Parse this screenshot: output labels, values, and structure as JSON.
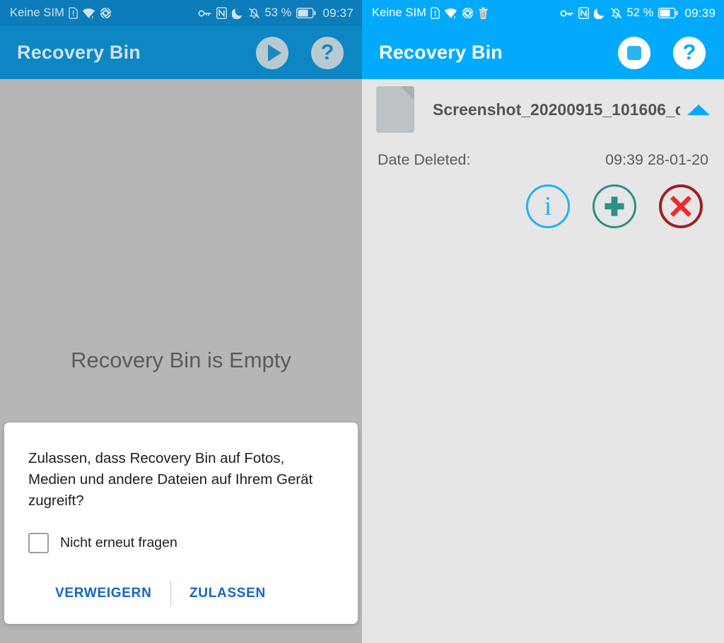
{
  "left": {
    "statusbar": {
      "carrier": "Keine SIM",
      "icons_left": [
        "sim-alert-icon",
        "wifi-icon",
        "camera-shutter-icon"
      ],
      "icons_right": [
        "vpn-key-icon",
        "nfc-icon",
        "do-not-disturb-moon-icon",
        "mute-bell-icon"
      ],
      "battery_percent": "53 %",
      "battery_icon": "battery-icon",
      "clock": "09:37"
    },
    "appbar": {
      "title": "Recovery Bin",
      "play_label": "play-icon",
      "help_label": "?"
    },
    "empty_message": "Recovery Bin is Empty",
    "dialog": {
      "message": "Zulassen, dass Recovery Bin auf Fotos, Medien und andere Dateien auf Ihrem Gerät zugreift?",
      "checkbox_label": "Nicht erneut fragen",
      "checkbox_checked": false,
      "deny_label": "VERWEIGERN",
      "allow_label": "ZULASSEN"
    }
  },
  "right": {
    "statusbar": {
      "carrier": "Keine SIM",
      "icons_left": [
        "sim-alert-icon",
        "wifi-icon",
        "camera-shutter-icon",
        "trash-bin-icon"
      ],
      "icons_right": [
        "vpn-key-icon",
        "nfc-icon",
        "do-not-disturb-moon-icon",
        "mute-bell-icon"
      ],
      "battery_percent": "52 %",
      "battery_icon": "battery-icon",
      "clock": "09:39"
    },
    "appbar": {
      "title": "Recovery Bin",
      "stop_label": "stop-icon",
      "help_label": "?"
    },
    "file": {
      "name": "Screenshot_20200915_101606_c..",
      "date_label": "Date Deleted:",
      "date_value": "09:39 28-01-20",
      "actions": {
        "info": "i",
        "restore": "restore-plus-icon",
        "delete": "delete-cross-icon"
      }
    }
  },
  "colors": {
    "appbar_active": "#03aafb",
    "appbar_dimmed": "#0d86c4",
    "accent_blue": "#1565c0",
    "info_blue": "#21b2f5",
    "restore_green": "#2e8f84",
    "delete_red": "#ee2a2a",
    "delete_ring": "#9e1f1f",
    "scrim_gray": "#b6b6b6",
    "panel_gray": "#e6e6e6"
  }
}
